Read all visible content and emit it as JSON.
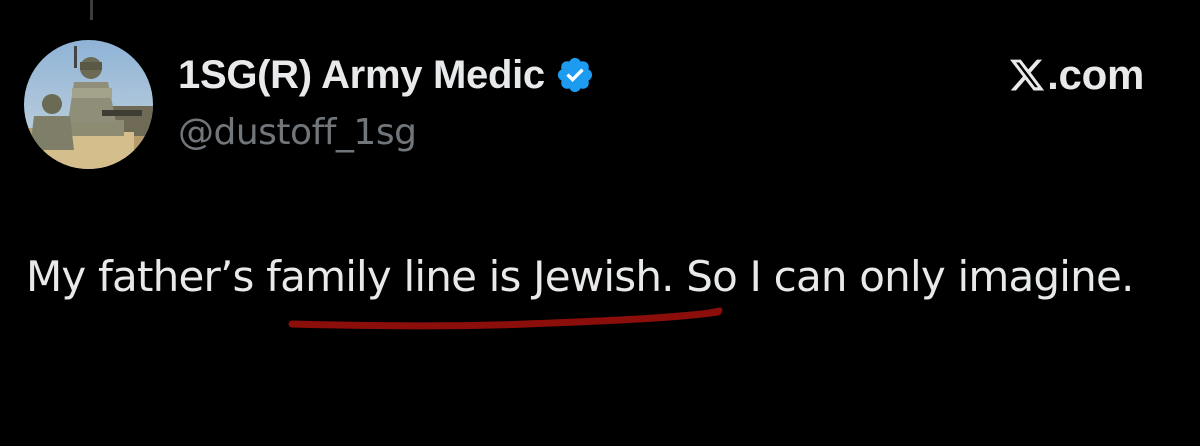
{
  "post": {
    "display_name": "1SG(R) Army Medic",
    "handle": "@dustoff_1sg",
    "verified_icon": "verified-badge-icon",
    "text": {
      "before": "My father’s ",
      "highlighted": "family line is Jewish",
      "after": ". So I can only imagine."
    }
  },
  "brand": {
    "logo_icon": "x-logo-icon",
    "domain": ".com"
  },
  "colors": {
    "background": "#000000",
    "text_primary": "#e7e9ea",
    "text_secondary": "#71767b",
    "verified": "#1d9bf0",
    "annotation_underline": "#8b0e0b"
  }
}
